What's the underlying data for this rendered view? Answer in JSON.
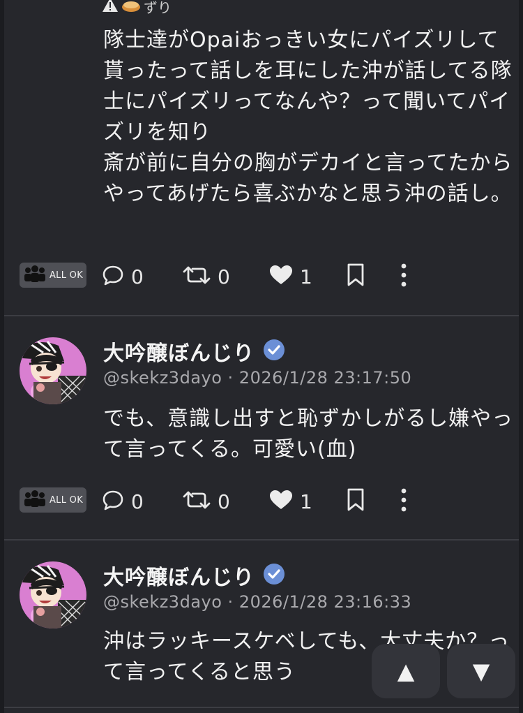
{
  "post1": {
    "cw_emoji_label": "ずり",
    "text": "隊士達がOpaiおっきい女にパイズリして貰ったって話しを耳にした沖が話してる隊士にパイズリってなんや？って聞いてパイズリを知り\n斎が前に自分の胸がデカイと言ってたからやってあげたら喜ぶかなと思う沖の話し。",
    "visibility_badge": "ALL OK",
    "replies": "0",
    "renotes": "0",
    "likes": "1"
  },
  "post2": {
    "author_name": "大吟醸ぼんじり",
    "handle_time": "@skekz3dayo · 2026/1/28 23:17:50",
    "text": "でも、意識し出すと恥ずかしがるし嫌やって言ってくる。可愛い(血)",
    "visibility_badge": "ALL OK",
    "replies": "0",
    "renotes": "0",
    "likes": "1"
  },
  "post3": {
    "author_name": "大吟醸ぼんじり",
    "handle_time": "@skekz3dayo · 2026/1/28 23:16:33",
    "text": "沖はラッキースケベしても、大丈夫か？って言ってくると思う"
  },
  "nav": {
    "up_label": "▲",
    "down_label": "▼"
  },
  "colors": {
    "background": "#26272c",
    "separator": "#3c3d43",
    "verified": "#6b8fd6",
    "badge": "#4f5056"
  },
  "icons": [
    "warning-icon",
    "pie-emoji-icon",
    "people-icon",
    "reply-icon",
    "renote-icon",
    "heart-icon",
    "bookmark-icon",
    "more-icon",
    "verified-icon"
  ]
}
